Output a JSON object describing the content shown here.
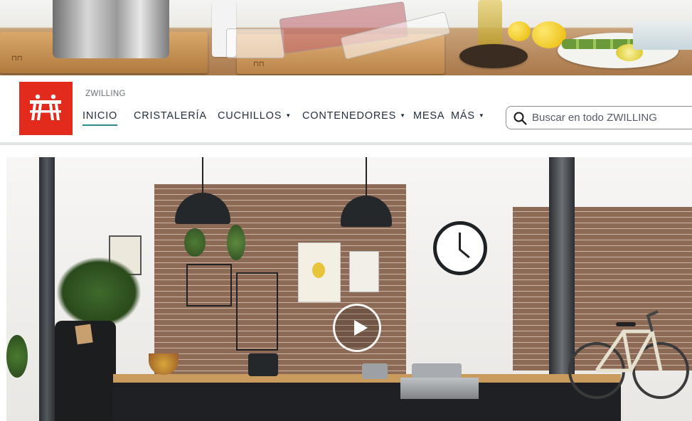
{
  "banner": {
    "image": "kitchen-countertop-photo"
  },
  "header": {
    "brand_label": "ZWILLING",
    "logo_icon": "zwilling-twins-logo-icon",
    "nav": [
      {
        "label": "INICIO",
        "active": true,
        "has_caret": false
      },
      {
        "label": "CRISTALERÍA",
        "active": false,
        "has_caret": false
      },
      {
        "label": "CUCHILLOS",
        "active": false,
        "has_caret": true
      },
      {
        "label": "CONTENEDORES",
        "active": false,
        "has_caret": true
      },
      {
        "label": "MESA",
        "active": false,
        "has_caret": false
      },
      {
        "label": "MÁS",
        "active": false,
        "has_caret": true
      }
    ],
    "search": {
      "placeholder": "Buscar en todo ZWILLING",
      "icon": "search-icon"
    }
  },
  "hero": {
    "image": "loft-kitchen-video-still",
    "play_icon": "play-icon"
  },
  "colors": {
    "brand_red": "#e22b1d",
    "active_underline": "#2d8a8a",
    "text": "#232f3e"
  }
}
